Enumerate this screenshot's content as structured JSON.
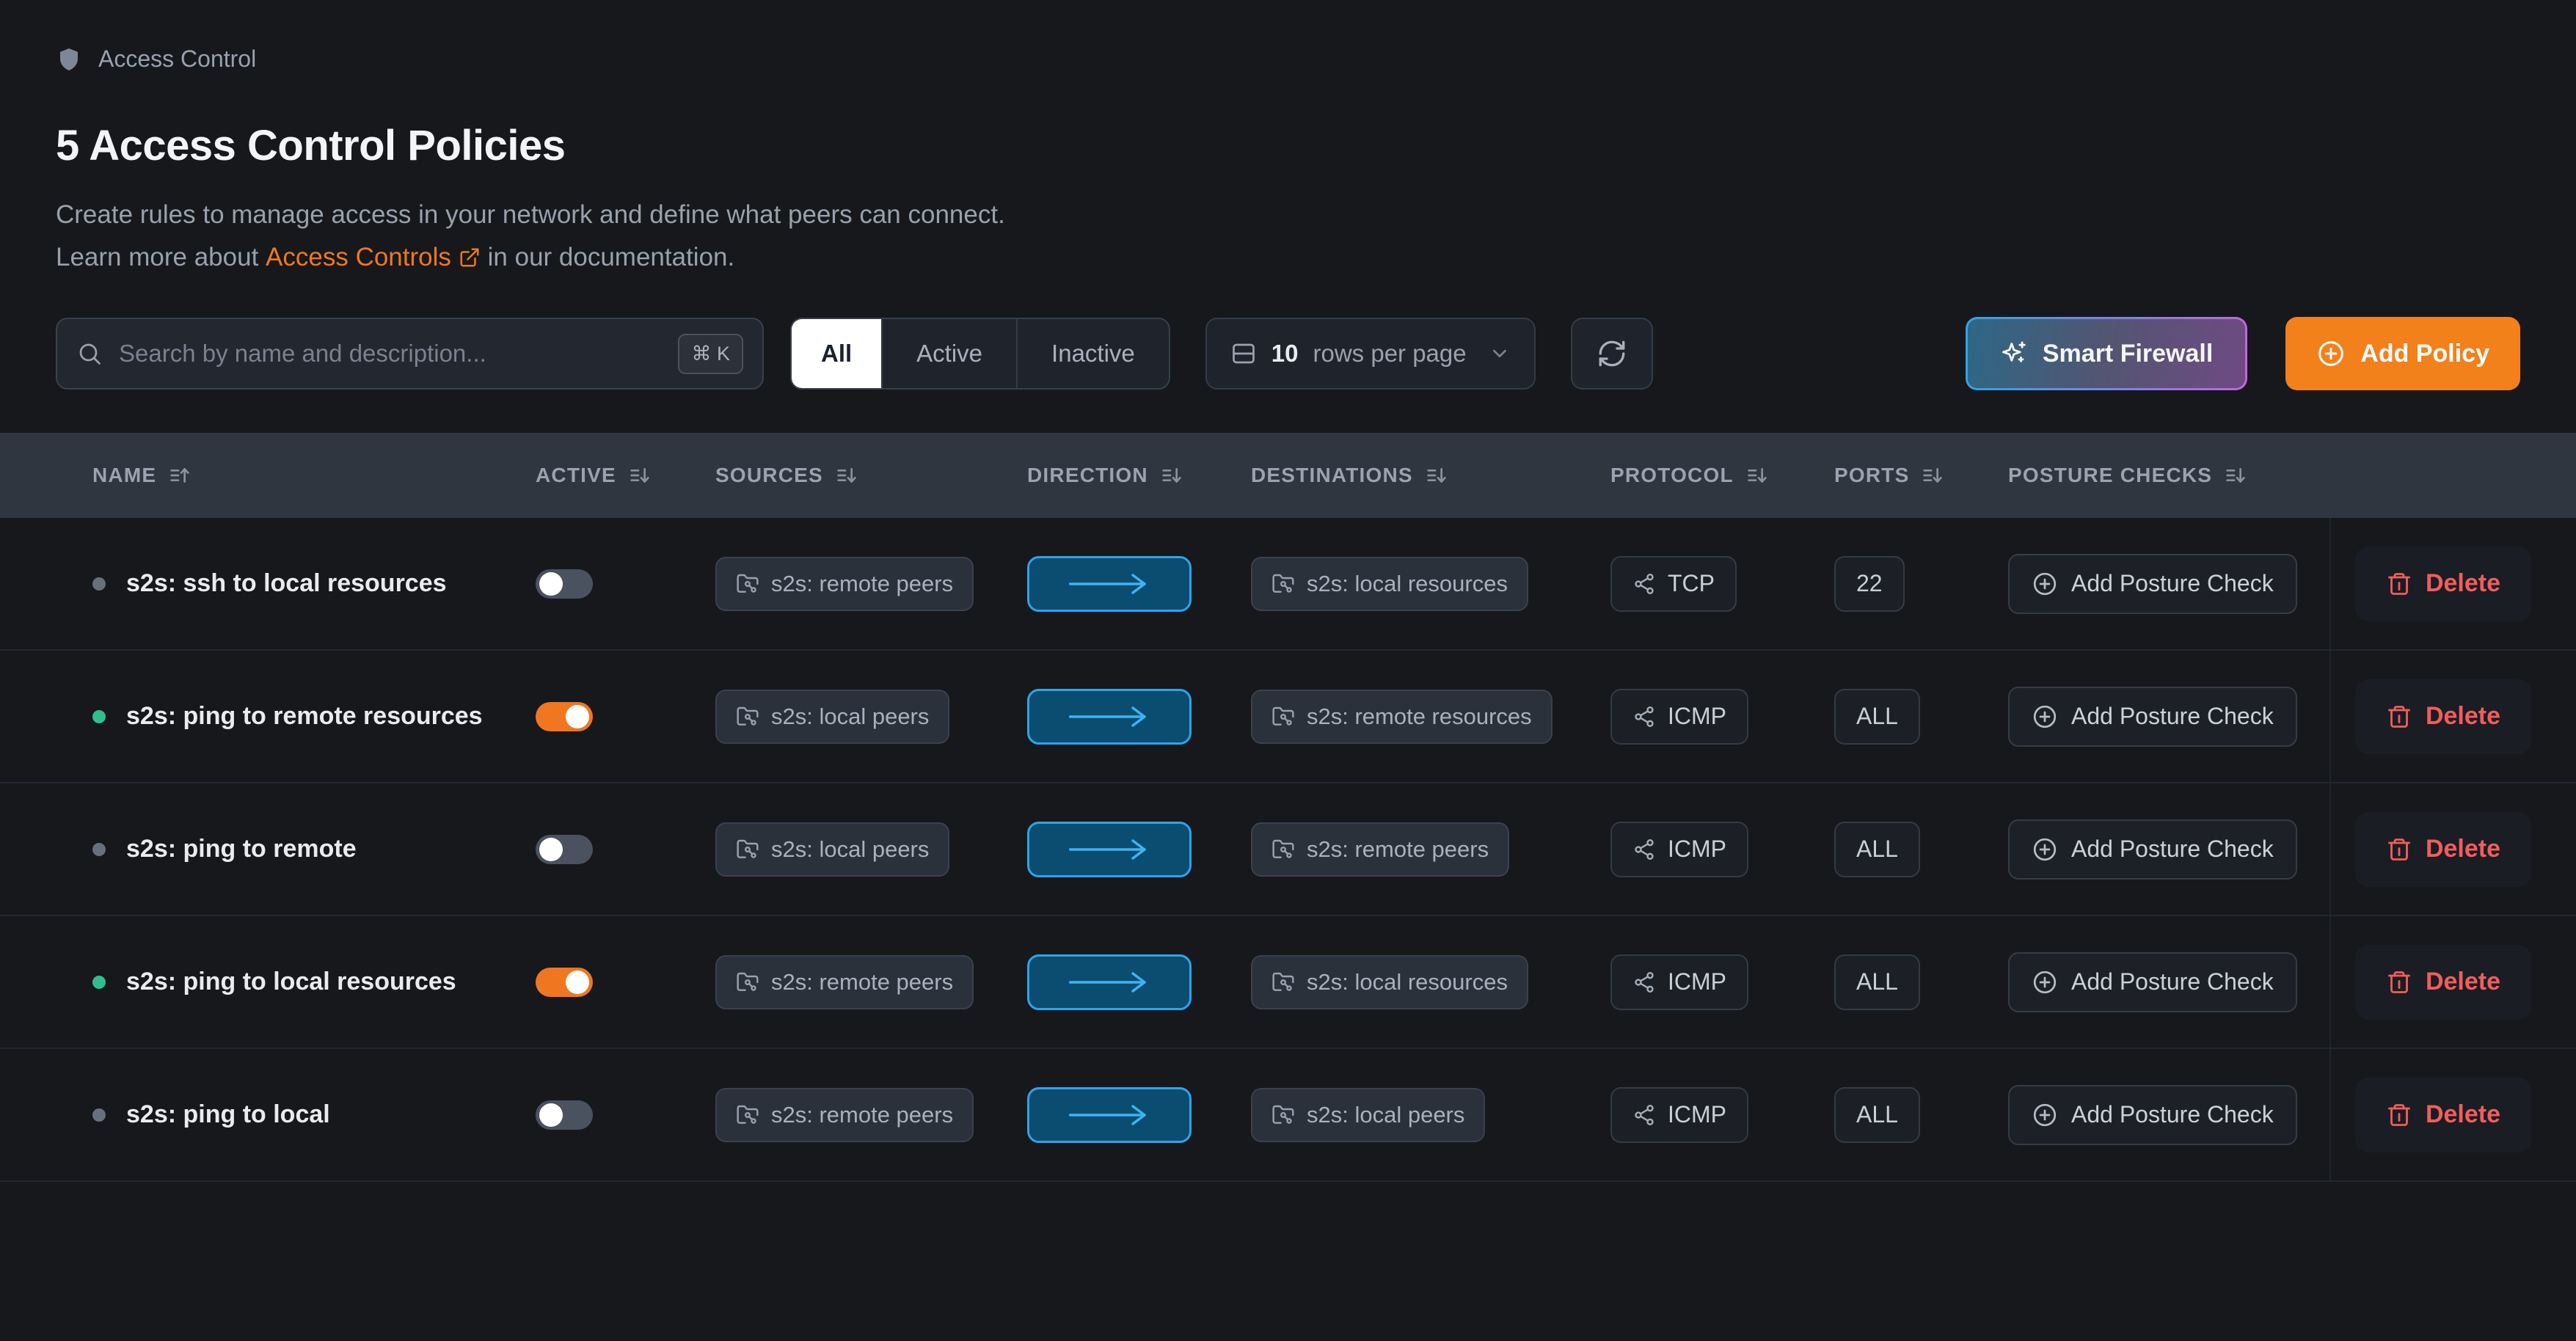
{
  "breadcrumb": {
    "label": "Access Control"
  },
  "header": {
    "title": "5 Access Control Policies",
    "description_line1": "Create rules to manage access in your network and define what peers can connect.",
    "learn_more_prefix": "Learn more about",
    "learn_more_link": "Access Controls",
    "learn_more_suffix": "in our documentation."
  },
  "toolbar": {
    "search_placeholder": "Search by name and description...",
    "search_shortcut": "⌘ K",
    "tabs": [
      {
        "label": "All",
        "active": true
      },
      {
        "label": "Active",
        "active": false
      },
      {
        "label": "Inactive",
        "active": false
      }
    ],
    "rows_per_page": {
      "count": "10",
      "label": "rows per page"
    },
    "smart_firewall_label": "Smart Firewall",
    "add_policy_label": "Add Policy"
  },
  "table": {
    "columns": [
      {
        "label": "NAME",
        "sort": "asc"
      },
      {
        "label": "ACTIVE",
        "sort": "desc"
      },
      {
        "label": "SOURCES",
        "sort": "desc"
      },
      {
        "label": "DIRECTION",
        "sort": "desc"
      },
      {
        "label": "DESTINATIONS",
        "sort": "desc"
      },
      {
        "label": "PROTOCOL",
        "sort": "desc"
      },
      {
        "label": "PORTS",
        "sort": "desc"
      },
      {
        "label": "POSTURE CHECKS",
        "sort": "desc"
      }
    ],
    "rows": [
      {
        "name": "s2s: ssh to local resources",
        "active": false,
        "source": "s2s: remote peers",
        "destination": "s2s: local resources",
        "protocol": "TCP",
        "ports": "22"
      },
      {
        "name": "s2s: ping to remote resources",
        "active": true,
        "source": "s2s: local peers",
        "destination": "s2s: remote resources",
        "protocol": "ICMP",
        "ports": "ALL"
      },
      {
        "name": "s2s: ping to remote",
        "active": false,
        "source": "s2s: local peers",
        "destination": "s2s: remote peers",
        "protocol": "ICMP",
        "ports": "ALL"
      },
      {
        "name": "s2s: ping to local resources",
        "active": true,
        "source": "s2s: remote peers",
        "destination": "s2s: local resources",
        "protocol": "ICMP",
        "ports": "ALL"
      },
      {
        "name": "s2s: ping to local",
        "active": false,
        "source": "s2s: remote peers",
        "destination": "s2s: local peers",
        "protocol": "ICMP",
        "ports": "ALL"
      }
    ]
  },
  "labels": {
    "add_posture_check": "Add Posture Check",
    "delete": "Delete"
  },
  "icons": {
    "breadcrumb": "shield-icon",
    "search": "search-icon",
    "shortcut": "command-key",
    "rows_select": "rows-icon + chevron-down-icon",
    "refresh": "refresh-icon",
    "smart_firewall": "sparkles-icon",
    "add_policy": "plus-circle-icon",
    "group_chip": "folder-git-icon",
    "direction": "arrow-right-icon",
    "protocol": "share-nodes-icon",
    "posture": "plus-circle-icon",
    "delete": "trash-icon",
    "sort": "sort-lines-arrow-icon",
    "doc_link": "external-link-icon"
  },
  "colors": {
    "orange": "#f2811c",
    "link-orange": "#f0771e",
    "delete-red": "#f15d5d",
    "direction-blue": "#2ea4e9",
    "direction-bg": "#0b4c71",
    "direction-arrow": "#3fb3f2",
    "active-green": "#30be8d",
    "inactive-gray": "#68707d",
    "toggle-off": "#4a5260",
    "toggle-on": "#f0771f",
    "page-bg": "#16181c",
    "band-bg": "#30363f",
    "chip-bg": "#2b313b",
    "chip-border": "#3a414d"
  }
}
